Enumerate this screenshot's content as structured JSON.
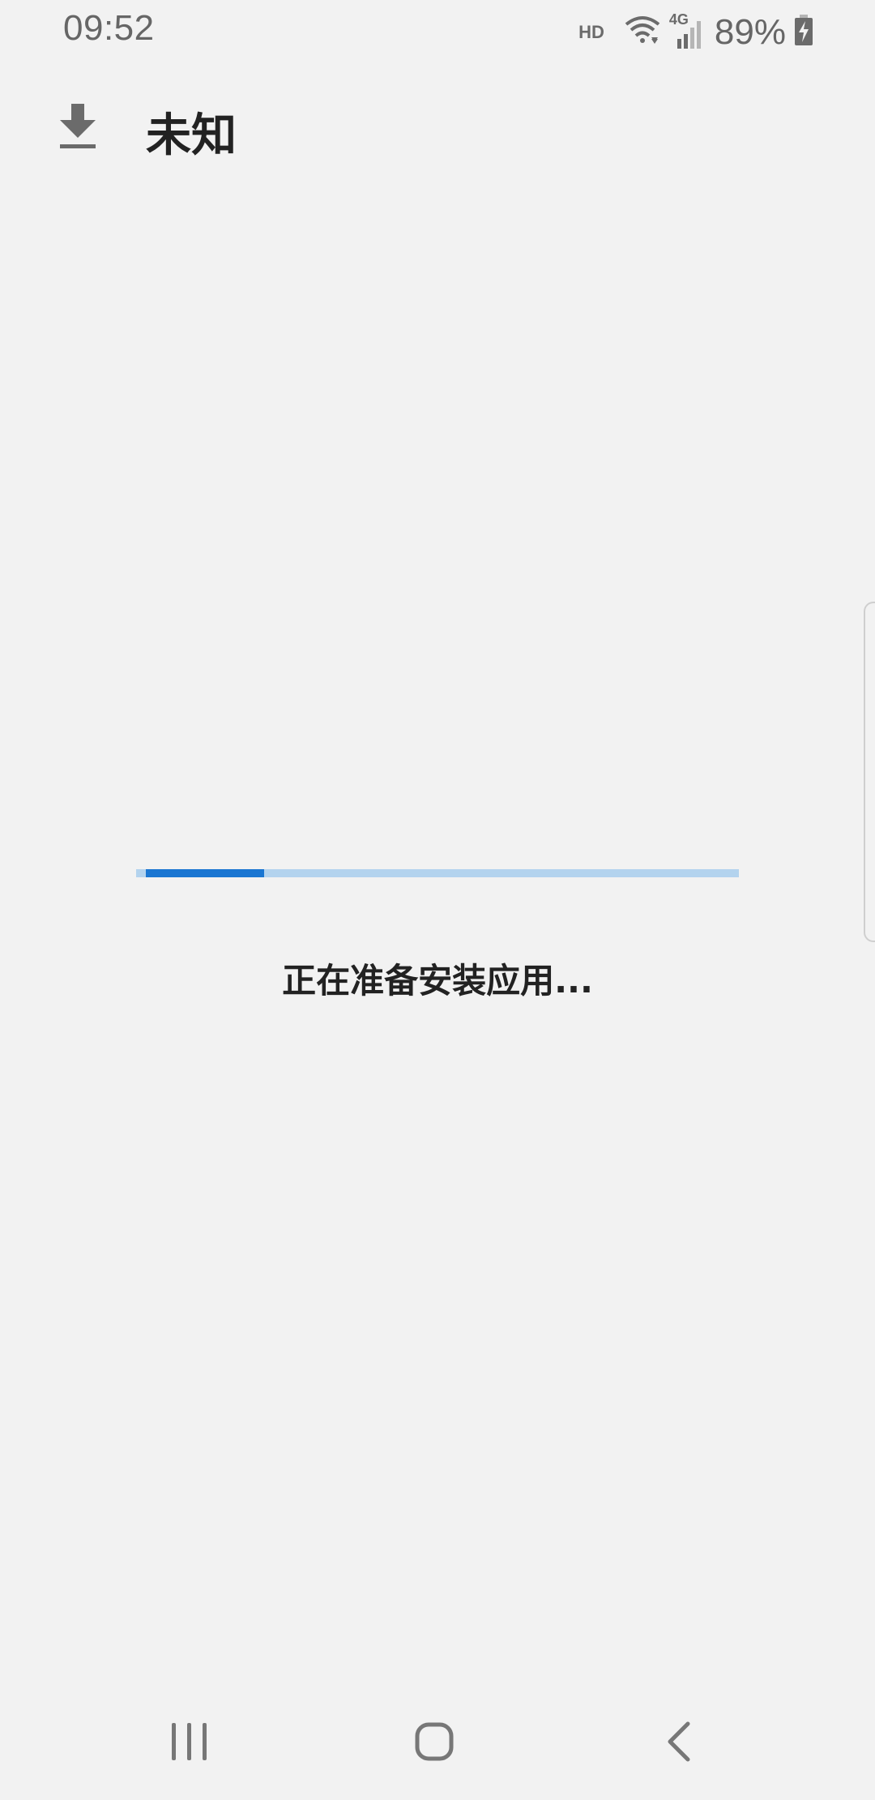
{
  "status_bar": {
    "time": "09:52",
    "hd_label": "HD",
    "network_label": "4G",
    "battery_percent": "89%",
    "icons": [
      "wifi-icon",
      "signal-icon",
      "battery-charging-icon"
    ]
  },
  "header": {
    "icon": "download-icon",
    "title": "未知"
  },
  "install": {
    "progress": 0.2,
    "message": "正在准备安装应用...",
    "track_color": "#b3d3ee",
    "fill_color": "#1a76d2"
  },
  "nav_bar": {
    "icons": [
      "recents-icon",
      "home-icon",
      "back-icon"
    ]
  },
  "colors": {
    "background": "#f2f2f2",
    "text": "#222222",
    "accent": "#1a76d2"
  }
}
